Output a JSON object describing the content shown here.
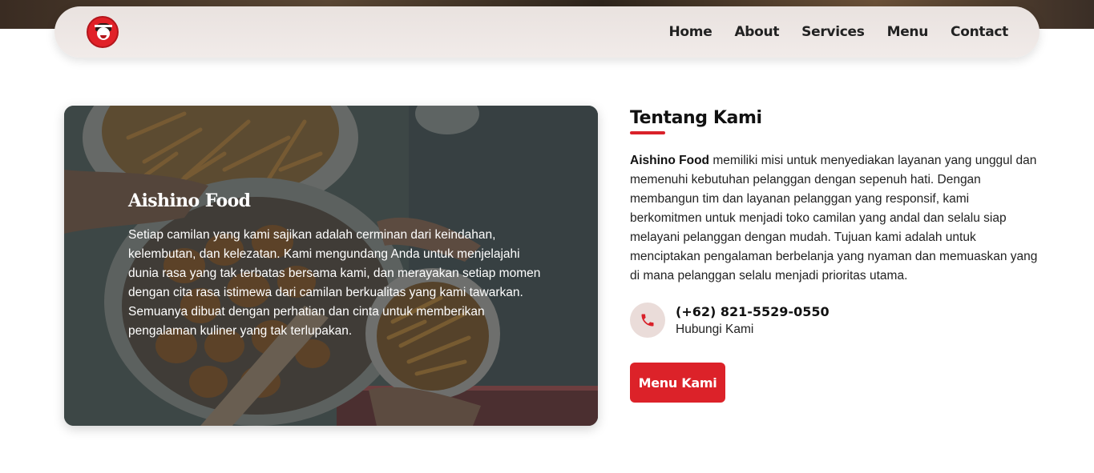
{
  "nav": {
    "logo_icon": "aishino-food-logo",
    "links": [
      {
        "label": "Home"
      },
      {
        "label": "About"
      },
      {
        "label": "Services"
      },
      {
        "label": "Menu"
      },
      {
        "label": "Contact"
      }
    ]
  },
  "feature": {
    "title": "Aishino Food",
    "body": "Setiap camilan yang kami sajikan adalah cerminan dari keindahan, kelembutan, dan kelezatan. Kami mengundang Anda untuk menjelajahi dunia rasa yang tak terbatas bersama kami, dan merayakan setiap momen dengan cita rasa istimewa dari camilan berkualitas yang kami tawarkan. Semuanya dibuat dengan perhatian dan cinta untuk memberikan pengalaman kuliner yang tak terlupakan."
  },
  "about": {
    "title": "Tentang Kami",
    "brand": "Aishino Food",
    "text": " memiliki misi untuk menyediakan layanan yang unggul dan memenuhi kebutuhan pelanggan dengan sepenuh hati. Dengan membangun tim dan layanan pelanggan yang responsif, kami berkomitmen untuk menjadi toko camilan yang andal dan selalu siap melayani pelanggan dengan mudah. Tujuan kami adalah untuk menciptakan pengalaman berbelanja yang nyaman dan memuaskan yang di mana pelanggan selalu menjadi prioritas utama."
  },
  "contact": {
    "icon": "phone-icon",
    "phone": "(+62) 821-5529-0550",
    "caption": "Hubungi Kami"
  },
  "cta": {
    "label": "Menu Kami"
  },
  "colors": {
    "accent": "#dc2229",
    "nav_bg": "#ede6e3",
    "icon_circle": "#eadcd9"
  }
}
